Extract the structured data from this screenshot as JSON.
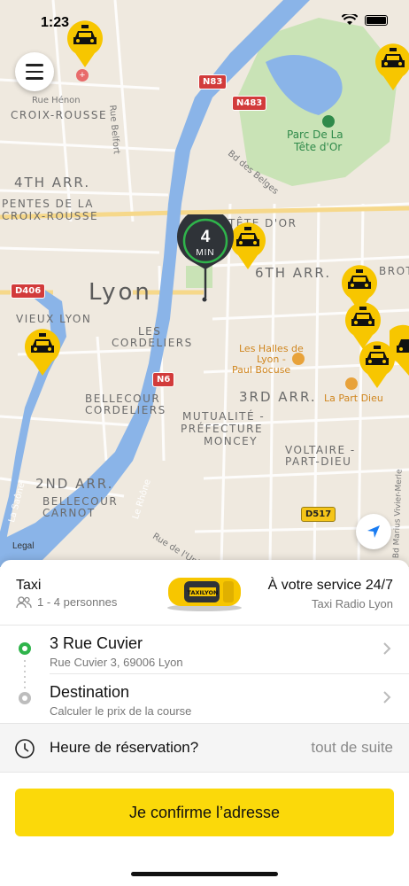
{
  "status_bar": {
    "time": "1:23"
  },
  "map": {
    "labels": {
      "lyon": "Lyon",
      "arr4": "4TH ARR.",
      "arr6": "6TH ARR.",
      "arr3": "3RD ARR.",
      "arr2": "2ND ARR.",
      "croix_rousse": "CROIX-ROUSSE",
      "pentes": "PENTES DE LA",
      "pentes2": "CROIX-ROUSSE",
      "vieux_lyon": "VIEUX LYON",
      "cordeliers1": "LES",
      "cordeliers2": "CORDELIERS",
      "bellecour1": "BELLECOUR",
      "bellecour2": "CORDELIERS",
      "mutualite1": "MUTUALITÉ -",
      "mutualite2": "PRÉFECTURE",
      "mutualite3": "MONCEY",
      "voltaire1": "VOLTAIRE -",
      "voltaire2": "PART-DIEU",
      "carnot1": "BELLECOUR",
      "carnot2": "CARNOT",
      "brot": "BROT",
      "tete_dor_arr": "TÊTE D'OR",
      "rue_henon": "Rue Hénon",
      "rue_belfort": "Rue Belfort",
      "bd_belges": "Bd des Belges",
      "rue_univ": "Rue de l'Univ",
      "le_rhone": "Le Rhône",
      "la_saone": "La Saône",
      "bd_marius": "Bd Marius Vivier-Merle",
      "parc1": "Parc De La",
      "parc2": "Tête d'Or",
      "halles1": "Les Halles de",
      "halles2": "Lyon -",
      "halles3": "Paul Bocuse",
      "part_dieu": "La Part Dieu",
      "legal": "Legal"
    },
    "shields": {
      "n83": "N83",
      "n483": "N483",
      "d406": "D406",
      "n6": "N6",
      "d517": "D517"
    },
    "eta": {
      "value": "4",
      "unit": "MIN"
    },
    "colors": {
      "pin": "#f7c600",
      "eta_bubble": "#2f3338",
      "eta_ring": "#2fb44b",
      "river": "#8ab4e8",
      "park": "#c9e3b6"
    }
  },
  "sheet": {
    "service": {
      "title": "Taxi",
      "capacity": "1 - 4 personnes",
      "availability": "À votre service 24/7",
      "company": "Taxi Radio Lyon",
      "car_badge": "TAXILYON"
    },
    "pickup": {
      "title": "3 Rue Cuvier",
      "subtitle": "Rue Cuvier 3, 69006 Lyon"
    },
    "destination": {
      "title": "Destination",
      "subtitle": "Calculer le prix de la course"
    },
    "booking_time": {
      "label": "Heure de réservation?",
      "value": "tout de suite"
    },
    "confirm_label": "Je confirme l’adresse",
    "accent": "#fbd90a"
  }
}
